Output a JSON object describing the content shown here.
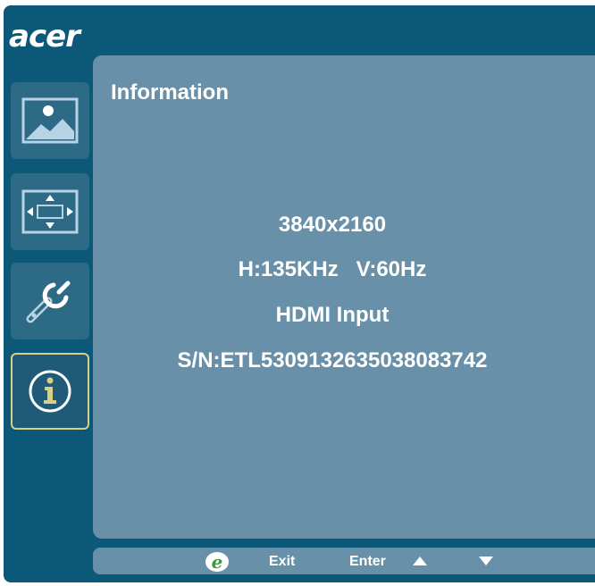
{
  "brand": {
    "logo_text": "acer"
  },
  "sidebar": {
    "items": [
      {
        "icon": "picture-icon",
        "active": false
      },
      {
        "icon": "display-position-icon",
        "active": false
      },
      {
        "icon": "settings-wrench-icon",
        "active": false
      },
      {
        "icon": "info-icon",
        "active": true
      }
    ]
  },
  "panel": {
    "title": "Information",
    "resolution": "3840x2160",
    "frequency": "H:135KHz   V:60Hz",
    "input": "HDMI Input",
    "serial": "S/N:ETL5309132635038083742"
  },
  "bottom_bar": {
    "exit_label": "Exit",
    "enter_label": "Enter",
    "icons": [
      "empowering-key-icon",
      "arrow-up-icon",
      "arrow-down-icon"
    ]
  },
  "colors": {
    "frame": "#0c5878",
    "panel": "#6891a9",
    "sidebar_item": "#2c6a86",
    "active_border": "#d8cf86",
    "icon_light": "#b8d4e4",
    "e_key_green": "#3c9c3c"
  }
}
